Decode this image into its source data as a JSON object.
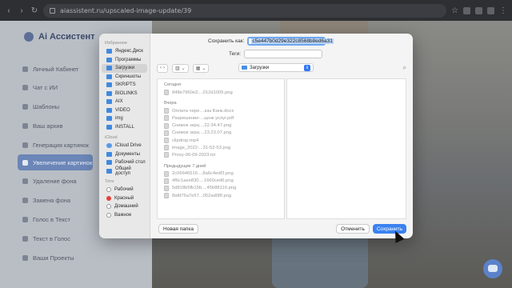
{
  "browser": {
    "url": "aiassistent.ru/upscaled-image-update/39"
  },
  "app": {
    "logo": "Ai Ассистент",
    "sidebar": [
      {
        "label": "Личный Кабинет"
      },
      {
        "label": "Чат с ИИ"
      },
      {
        "label": "Шаблоны"
      },
      {
        "label": "Ваш архив"
      },
      {
        "label": "Генерация картинок"
      },
      {
        "label": "Увеличение картинок",
        "active": true
      },
      {
        "label": "Удаление фона"
      },
      {
        "label": "Замена фона"
      },
      {
        "label": "Голос в Текст"
      },
      {
        "label": "Текст в Голос"
      },
      {
        "label": "Ваши Проекты"
      }
    ]
  },
  "dialog": {
    "save_as_label": "Сохранить как:",
    "save_as_value": "c5e447b0d29e322c8568b8ed6a31",
    "tags_label": "Теги:",
    "location": "Загрузки",
    "sidebar": {
      "favorites_head": "Избранное",
      "favorites": [
        "Яндекс.Диск",
        "Программы",
        "Загрузки",
        "Скриншоты",
        "SKRIPTS",
        "BIOLINKS",
        "AIX",
        "VIDEO",
        "img",
        "INSTALL"
      ],
      "selected": "Загрузки",
      "icloud_head": "iCloud",
      "icloud": [
        "iCloud Drive",
        "Документы",
        "Рабочий стол",
        "Общий доступ"
      ],
      "tags_head": "Теги",
      "tags": [
        {
          "label": "Рабочий",
          "color": "#ffffff"
        },
        {
          "label": "Красный",
          "color": "#e2413a"
        },
        {
          "label": "Домашний",
          "color": "#ffffff"
        },
        {
          "label": "Важное",
          "color": "#ffffff"
        }
      ]
    },
    "files": [
      {
        "group": "Сегодня",
        "items": [
          "848e7960e3....012d1005.png"
        ]
      },
      {
        "group": "Вчера",
        "items": [
          "Оплата чере....каз Банк.docx",
          "Разрешение-...ценк услуг.pdf",
          "Снимок экра....22.34.47.png",
          "Снимок экра....23.23.07.png",
          "clipdrop.mp4",
          "image_2022-...31-52-53.png",
          "Proxy-06-09-2023.txt"
        ]
      },
      {
        "group": "Предыдущие 7 дней",
        "items": [
          "2c06646516....8a6c4edf3.png",
          "4f6c1aee830....1660ced6.png",
          "5d818b5fb15b....45b8811б.png",
          "8afd76a7e57...052ad08f.png"
        ]
      }
    ],
    "buttons": {
      "new_folder": "Новая папка",
      "cancel": "Отменить",
      "save": "Сохранить"
    }
  }
}
